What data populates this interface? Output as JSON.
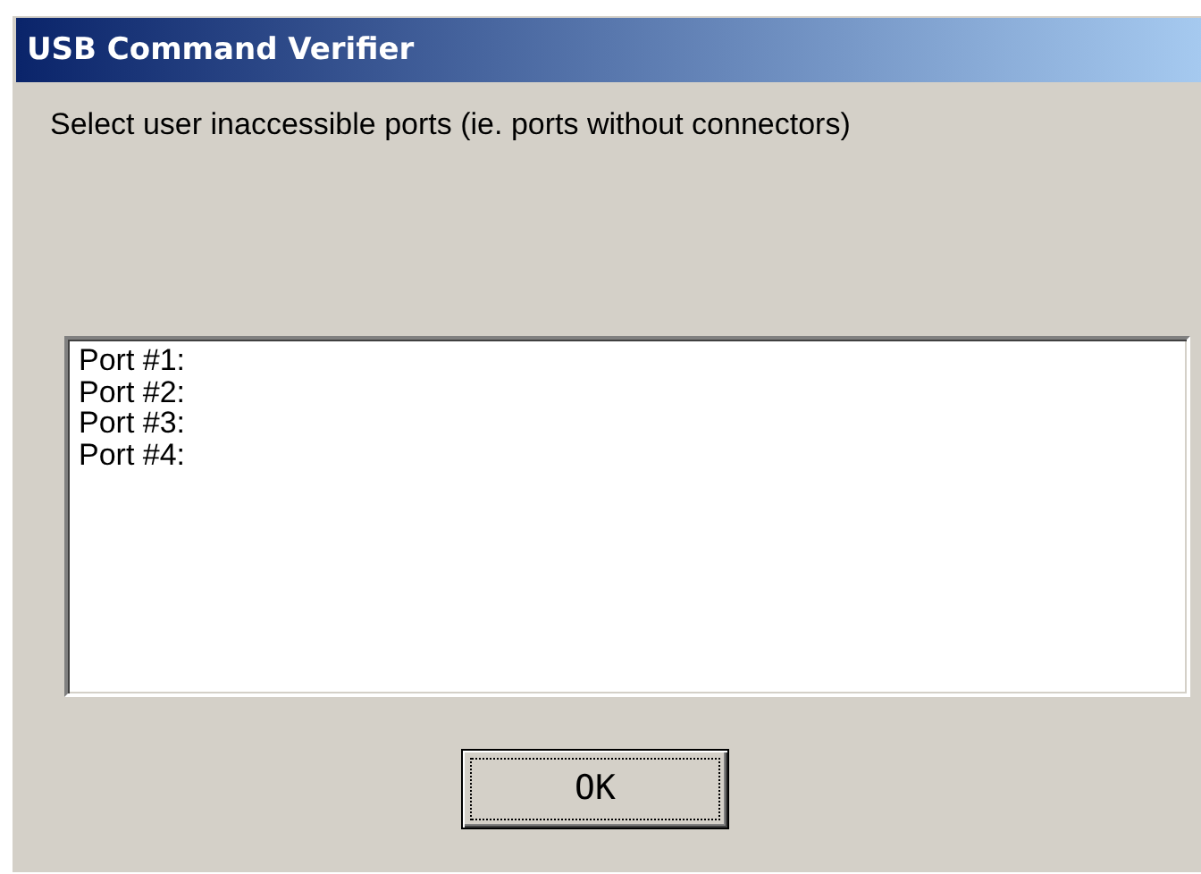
{
  "window": {
    "title": "USB Command Verifier"
  },
  "instruction": "Select user inaccessible ports (ie. ports without connectors)",
  "ports": [
    {
      "label": "Port #1:"
    },
    {
      "label": "Port #2:"
    },
    {
      "label": "Port #3:"
    },
    {
      "label": "Port #4:"
    }
  ],
  "buttons": [
    {
      "label": "OK",
      "default": true
    }
  ]
}
